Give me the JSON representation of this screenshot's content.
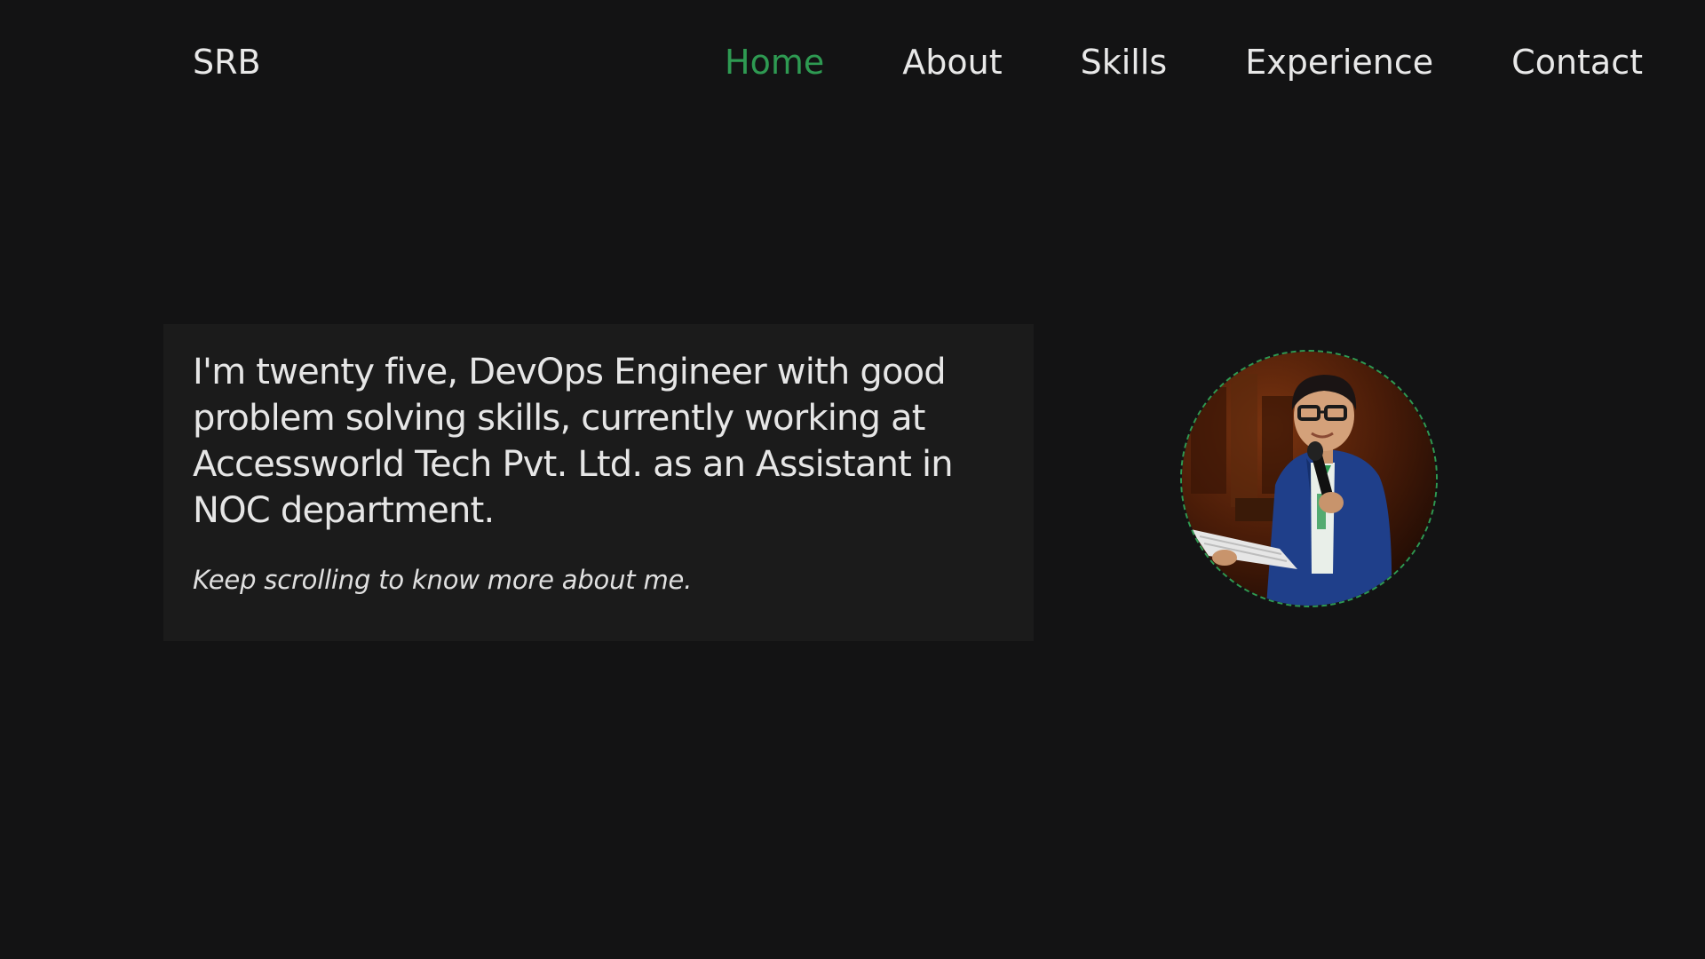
{
  "header": {
    "brand": "SRB",
    "nav": [
      {
        "label": "Home",
        "active": true
      },
      {
        "label": "About",
        "active": false
      },
      {
        "label": "Skills",
        "active": false
      },
      {
        "label": "Experience",
        "active": false
      },
      {
        "label": "Contact",
        "active": false
      }
    ]
  },
  "intro": {
    "text": "I'm twenty five, DevOps Engineer with good problem solving skills, currently working at Accessworld Tech Pvt. Ltd. as an Assistant in NOC department.",
    "hint": "Keep scrolling to know more about me."
  },
  "avatar": {
    "icon": "profile-photo",
    "ring_color": "#2e9a52"
  },
  "colors": {
    "background": "#131314",
    "card": "#1b1b1b",
    "accent": "#2e9a52",
    "text": "#e6e6e6"
  }
}
